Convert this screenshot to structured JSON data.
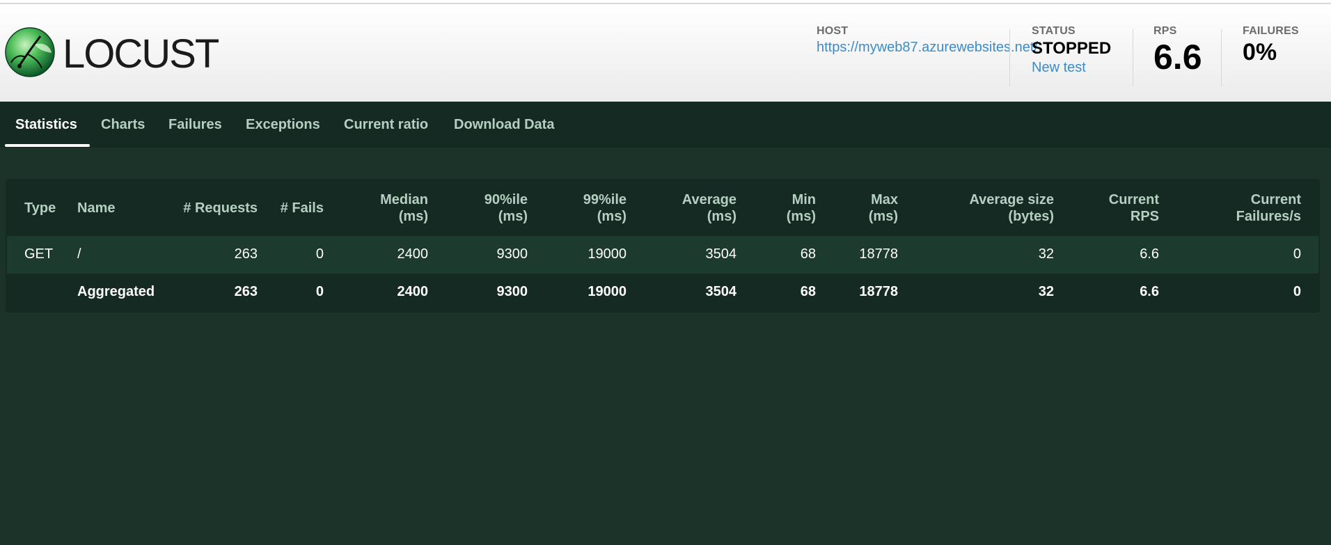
{
  "app": {
    "name": "LOCUST",
    "logo_icon": "locust-logo-icon"
  },
  "header": {
    "host_label": "HOST",
    "host_value": "https://myweb87.azurewebsites.net/",
    "status_label": "STATUS",
    "status_value": "STOPPED",
    "new_test_label": "New test",
    "rps_label": "RPS",
    "rps_value": "6.6",
    "failures_label": "FAILURES",
    "failures_value": "0%"
  },
  "tabs": [
    {
      "label": "Statistics",
      "active": true
    },
    {
      "label": "Charts",
      "active": false
    },
    {
      "label": "Failures",
      "active": false
    },
    {
      "label": "Exceptions",
      "active": false
    },
    {
      "label": "Current ratio",
      "active": false
    },
    {
      "label": "Download Data",
      "active": false
    }
  ],
  "table": {
    "headers": {
      "type": "Type",
      "name": "Name",
      "requests": "# Requests",
      "fails": "# Fails",
      "median": [
        "Median",
        "(ms)"
      ],
      "p90": [
        "90%ile",
        "(ms)"
      ],
      "p99": [
        "99%ile",
        "(ms)"
      ],
      "average": [
        "Average",
        "(ms)"
      ],
      "min": [
        "Min",
        "(ms)"
      ],
      "max": [
        "Max",
        "(ms)"
      ],
      "avg_size": [
        "Average size",
        "(bytes)"
      ],
      "current_rps": [
        "Current",
        "RPS"
      ],
      "current_failures": [
        "Current",
        "Failures/s"
      ]
    },
    "rows": [
      {
        "type": "GET",
        "name": "/",
        "requests": "263",
        "fails": "0",
        "median": "2400",
        "p90": "9300",
        "p99": "19000",
        "average": "3504",
        "min": "68",
        "max": "18778",
        "avg_size": "32",
        "current_rps": "6.6",
        "current_failures": "0"
      }
    ],
    "aggregated": {
      "type": "",
      "name": "Aggregated",
      "requests": "263",
      "fails": "0",
      "median": "2400",
      "p90": "9300",
      "p99": "19000",
      "average": "3504",
      "min": "68",
      "max": "18778",
      "avg_size": "32",
      "current_rps": "6.6",
      "current_failures": "0"
    }
  },
  "colors": {
    "background": "#1b3329",
    "nav": "#142a22",
    "link": "#3a8cc9",
    "header_text": "#b5cfc2"
  }
}
